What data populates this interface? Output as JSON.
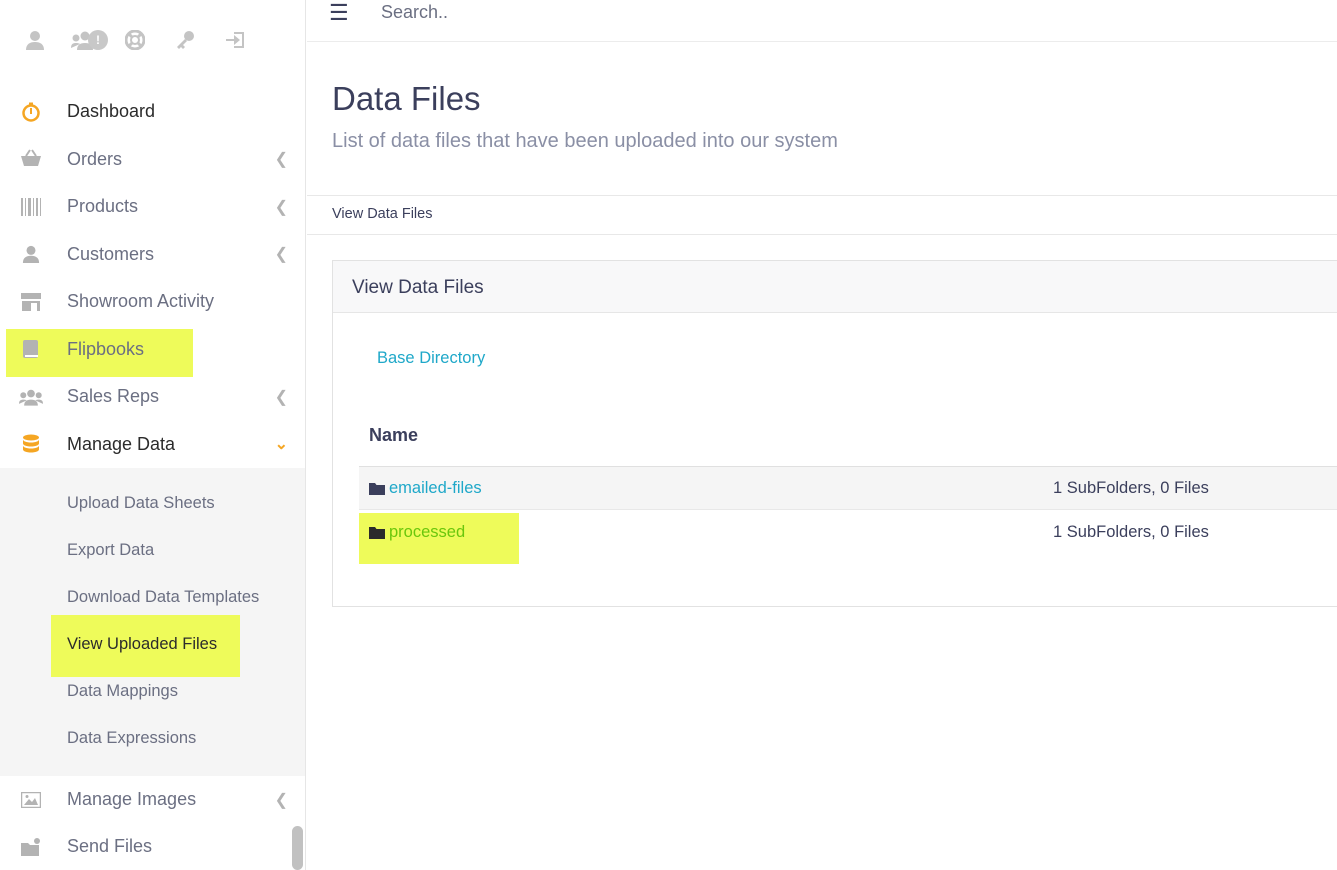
{
  "sidebar": {
    "top_icons": [
      "user-icon",
      "users-icon",
      "support-icon",
      "key-icon",
      "logout-icon"
    ],
    "users_badge": "!",
    "menu": [
      {
        "label": "Dashboard",
        "icon": "stopwatch-icon"
      },
      {
        "label": "Orders",
        "icon": "basket-icon"
      },
      {
        "label": "Products",
        "icon": "barcode-icon"
      },
      {
        "label": "Customers",
        "icon": "user-icon"
      },
      {
        "label": "Showroom Activity",
        "icon": "store-icon"
      },
      {
        "label": "Flipbooks",
        "icon": "book-icon"
      },
      {
        "label": "Sales Reps",
        "icon": "users-icon"
      },
      {
        "label": "Manage Data",
        "icon": "database-icon"
      }
    ],
    "submenu": [
      "Upload Data Sheets",
      "Export Data",
      "Download Data Templates",
      "View Uploaded Files",
      "Data Mappings",
      "Data Expressions"
    ],
    "menu_after": [
      {
        "label": "Manage Images",
        "icon": "image-icon"
      },
      {
        "label": "Send Files",
        "icon": "send-files-icon"
      }
    ]
  },
  "header": {
    "menu_icon": "☰",
    "search_placeholder": "Search.."
  },
  "page": {
    "title": "Data Files",
    "subtitle": "List of data files that have been uploaded into our system",
    "breadcrumb": "View Data Files"
  },
  "card": {
    "title": "View Data Files",
    "base_directory": "Base Directory",
    "column_name": "Name",
    "rows": [
      {
        "name": "emailed-files",
        "info": "1 SubFolders, 0 Files"
      },
      {
        "name": "processed",
        "info": "1 SubFolders, 0 Files"
      }
    ]
  },
  "colors": {
    "accent": "#1fa8c9",
    "highlight": "#eefb5a",
    "active_icon": "#f5a623",
    "processed_link": "#6ac70c"
  }
}
